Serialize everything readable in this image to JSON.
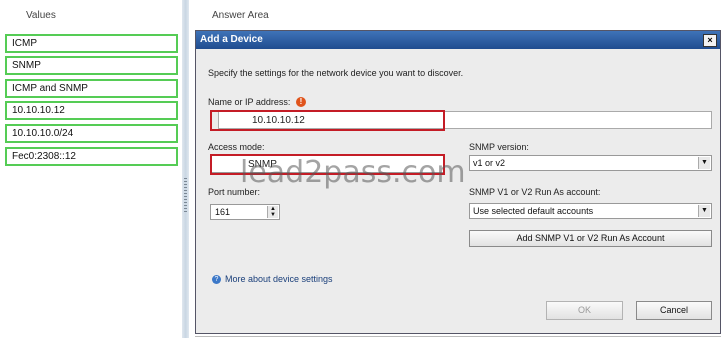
{
  "values_panel": {
    "header": "Values",
    "items": [
      "ICMP",
      "SNMP",
      "ICMP and SNMP",
      "10.10.10.12",
      "10.10.10.0/24",
      "Fec0:2308::12"
    ]
  },
  "answer_area": {
    "header": "Answer Area"
  },
  "dialog": {
    "title": "Add a Device",
    "close_glyph": "×",
    "intro": "Specify the settings for the network device you want to discover.",
    "name_label": "Name or IP address:",
    "name_value": "10.10.10.12",
    "warning_glyph": "!",
    "access_mode_label": "Access mode:",
    "access_mode_value": "SNMP",
    "snmp_version_label": "SNMP version:",
    "snmp_version_value": "v1 or v2",
    "port_label": "Port number:",
    "port_value": "161",
    "run_as_label": "SNMP V1 or V2 Run As account:",
    "run_as_value": "Use selected default accounts",
    "add_account_button": "Add SNMP V1 or V2 Run As Account",
    "help_link": "More about device settings",
    "ok_button": "OK",
    "cancel_button": "Cancel"
  },
  "watermark": "lead2pass.com",
  "colors": {
    "value_border": "#55cc55",
    "highlight_red": "#c41c26",
    "titlebar": "#1f4c8f"
  }
}
